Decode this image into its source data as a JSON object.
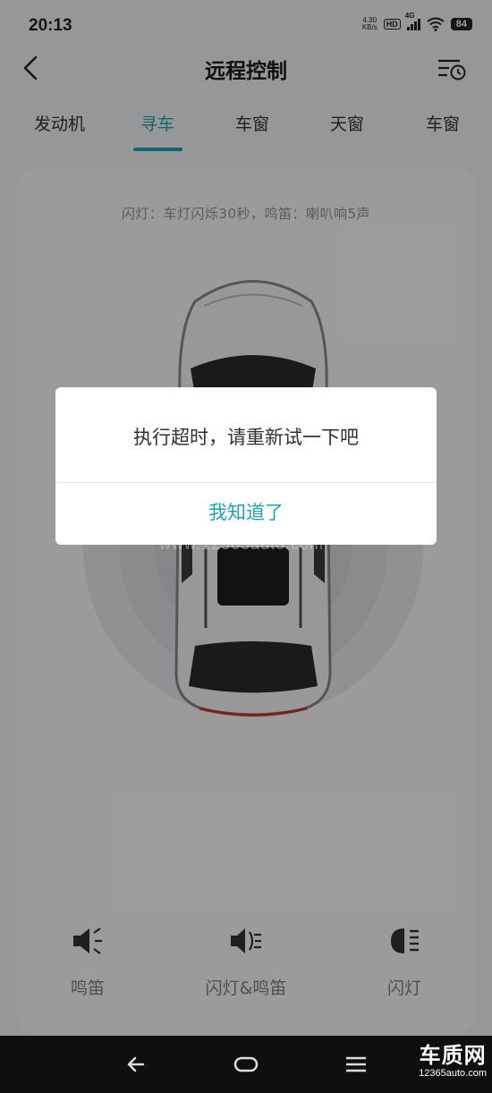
{
  "status_bar": {
    "time": "20:13",
    "net_speed_value": "4.30",
    "net_speed_unit": "KB/s",
    "hd_badge": "HD",
    "network_type": "4G",
    "battery": "84"
  },
  "nav": {
    "title": "远程控制"
  },
  "tabs": [
    {
      "label": "发动机",
      "active": false
    },
    {
      "label": "寻车",
      "active": true
    },
    {
      "label": "车窗",
      "active": false
    },
    {
      "label": "天窗",
      "active": false
    },
    {
      "label": "车窗",
      "active": false
    }
  ],
  "card": {
    "hint": "闪灯：车灯闪烁30秒，鸣笛：喇叭响5声"
  },
  "actions": [
    {
      "label": "鸣笛",
      "icon": "horn-icon"
    },
    {
      "label": "闪灯&鸣笛",
      "icon": "horn-light-icon"
    },
    {
      "label": "闪灯",
      "icon": "headlight-icon"
    }
  ],
  "dialog": {
    "message": "执行超时，请重新试一下吧",
    "confirm_label": "我知道了"
  },
  "watermark": {
    "text": "www.12365auto.com",
    "logo_text": "车质网",
    "logo_url": "12365auto.com"
  },
  "colors": {
    "accent": "#1fa3b3",
    "brand_red": "#e23b2e"
  }
}
